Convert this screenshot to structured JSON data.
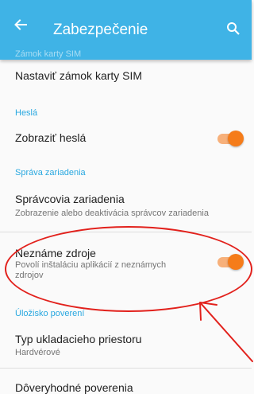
{
  "appbar": {
    "title": "Zabezpečenie",
    "back_icon": "arrow-back-icon",
    "search_icon": "search-icon",
    "color": "#3fb3e6"
  },
  "sections": {
    "sim_header_cut": "Zámok karty SIM",
    "passwords_header": "Heslá",
    "device_admin_header": "Správa zariadenia",
    "credentials_header": "Úložisko poverení"
  },
  "items": {
    "sim_lock": {
      "title": "Nastaviť zámok karty SIM"
    },
    "show_passwords": {
      "title": "Zobraziť heslá",
      "enabled": true
    },
    "device_admins": {
      "title": "Správcovia zariadenia",
      "subtitle": "Zobrazenie alebo deaktivácia správcov zariadenia"
    },
    "unknown_sources": {
      "title": "Neznáme zdroje",
      "subtitle": "Povolí inštaláciu aplikácií z neznámych zdrojov",
      "enabled": true
    },
    "storage_type": {
      "title": "Typ ukladacieho priestoru",
      "subtitle": "Hardvérové"
    },
    "trusted_credentials": {
      "title": "Dôveryhodné poverenia"
    }
  },
  "colors": {
    "accent": "#29a8e0",
    "toggle_on": "#f57c1a",
    "annotation": "#e2211c"
  }
}
